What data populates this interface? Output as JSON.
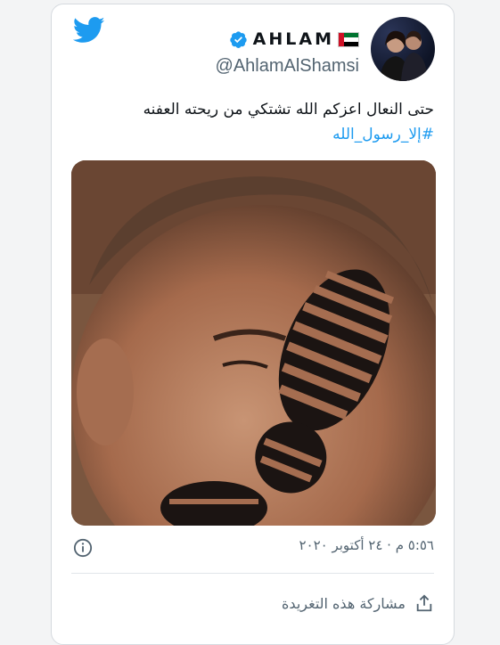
{
  "header": {
    "display_name": "AHLAM",
    "handle": "@AhlamAlShamsi",
    "icons": [
      "twitter-bird-icon",
      "verified-badge-icon",
      "uae-flag-icon"
    ]
  },
  "tweet": {
    "text": "حتى النعال اعزكم الله تشتكي من ريحته العفنه",
    "hashtag": "#إلا_رسول_الله",
    "timestamp": "٥:٥٦ م · ٢٤ أكتوبر ٢٠٢٠"
  },
  "footer": {
    "share_label": "مشاركة هذه التغريدة"
  },
  "colors": {
    "twitter_blue": "#1d9bf0",
    "text": "#0f1419",
    "secondary_text": "#536471"
  }
}
